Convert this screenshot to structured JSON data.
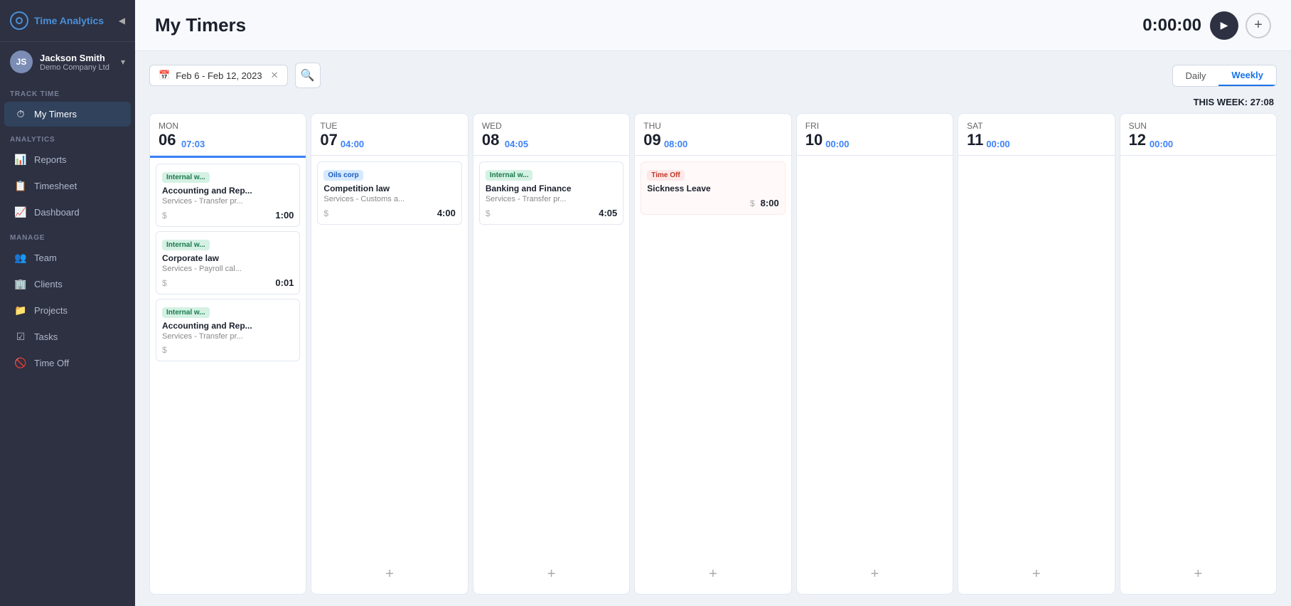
{
  "sidebar": {
    "logo_text": "Time Analytics",
    "collapse_icon": "◀",
    "user": {
      "name": "Jackson Smith",
      "company": "Demo Company Ltd",
      "initials": "JS"
    },
    "sections": [
      {
        "label": "TRACK TIME",
        "items": [
          {
            "id": "my-timers",
            "icon": "⏱",
            "label": "My Timers",
            "active": true
          }
        ]
      },
      {
        "label": "ANALYTICS",
        "items": [
          {
            "id": "reports",
            "icon": "📊",
            "label": "Reports",
            "active": false
          },
          {
            "id": "timesheet",
            "icon": "📋",
            "label": "Timesheet",
            "active": false
          },
          {
            "id": "dashboard",
            "icon": "📈",
            "label": "Dashboard",
            "active": false
          }
        ]
      },
      {
        "label": "MANAGE",
        "items": [
          {
            "id": "team",
            "icon": "👥",
            "label": "Team",
            "active": false
          },
          {
            "id": "clients",
            "icon": "🏢",
            "label": "Clients",
            "active": false
          },
          {
            "id": "projects",
            "icon": "📁",
            "label": "Projects",
            "active": false
          },
          {
            "id": "tasks",
            "icon": "☑",
            "label": "Tasks",
            "active": false
          },
          {
            "id": "time-off",
            "icon": "🚫",
            "label": "Time Off",
            "active": false
          }
        ]
      }
    ]
  },
  "header": {
    "title": "My Timers",
    "timer_value": "0:00:00",
    "play_icon": "▶",
    "add_icon": "+"
  },
  "toolbar": {
    "date_range": "Feb 6 - Feb 12, 2023",
    "calendar_icon": "📅",
    "clear_icon": "✕",
    "search_icon": "🔍",
    "view_daily": "Daily",
    "view_weekly": "Weekly",
    "active_view": "Weekly"
  },
  "week_summary": {
    "label": "THIS WEEK: 27:08"
  },
  "days": [
    {
      "name": "MON",
      "number": "06",
      "total": "07:03",
      "has_underline": true,
      "cards": [
        {
          "tag": "Internal w...",
          "tag_type": "green",
          "title": "Accounting and Rep...",
          "subtitle": "Services - Transfer pr...",
          "duration": "1:00"
        },
        {
          "tag": "Internal w...",
          "tag_type": "green",
          "title": "Corporate law",
          "subtitle": "Services - Payroll cal...",
          "duration": "0:01"
        },
        {
          "tag": "Internal w...",
          "tag_type": "green",
          "title": "Accounting and Rep...",
          "subtitle": "Services - Transfer pr...",
          "duration": ""
        }
      ],
      "show_add": false
    },
    {
      "name": "TUE",
      "number": "07",
      "total": "04:00",
      "has_underline": false,
      "cards": [
        {
          "tag": "Oils corp",
          "tag_type": "blue",
          "title": "Competition law",
          "subtitle": "Services - Customs a...",
          "duration": "4:00"
        }
      ],
      "show_add": true
    },
    {
      "name": "WED",
      "number": "08",
      "total": "04:05",
      "has_underline": false,
      "cards": [
        {
          "tag": "Internal w...",
          "tag_type": "green",
          "title": "Banking and Finance",
          "subtitle": "Services - Transfer pr...",
          "duration": "4:05"
        }
      ],
      "show_add": true
    },
    {
      "name": "THU",
      "number": "09",
      "total": "08:00",
      "has_underline": false,
      "cards": [],
      "time_off": {
        "tag": "Time Off",
        "title": "Sickness Leave",
        "hours": "8:00"
      },
      "show_add": true
    },
    {
      "name": "FRI",
      "number": "10",
      "total": "00:00",
      "has_underline": false,
      "cards": [],
      "show_add": true,
      "empty": true
    },
    {
      "name": "SAT",
      "number": "11",
      "total": "00:00",
      "has_underline": false,
      "cards": [],
      "show_add": true,
      "empty": true
    },
    {
      "name": "SUN",
      "number": "12",
      "total": "00:00",
      "has_underline": false,
      "cards": [],
      "show_add": true,
      "empty": true
    }
  ]
}
